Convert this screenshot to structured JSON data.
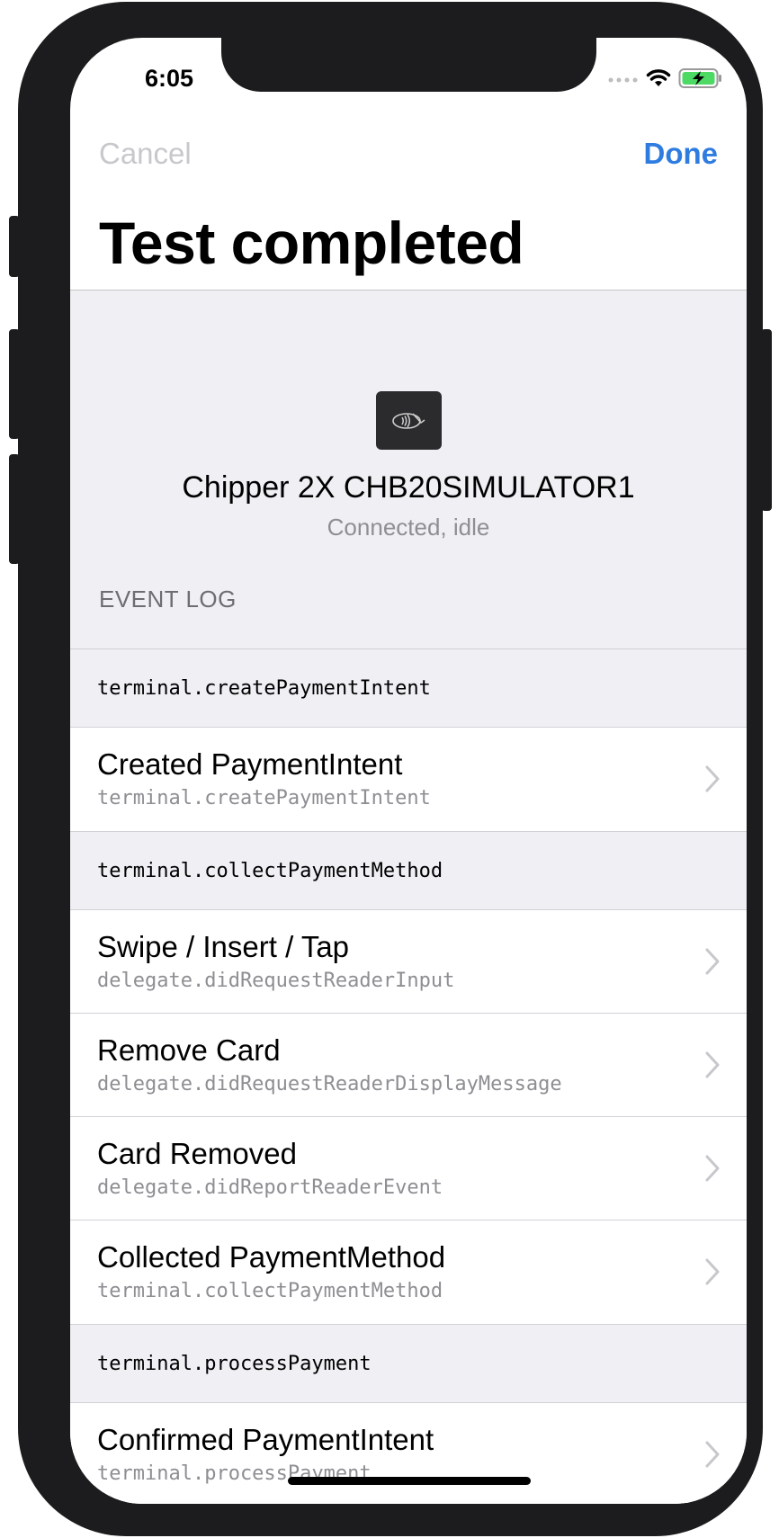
{
  "status_bar": {
    "time": "6:05",
    "icons": [
      "signal-icon",
      "wifi-icon",
      "battery-charging-icon"
    ]
  },
  "nav": {
    "cancel_label": "Cancel",
    "done_label": "Done",
    "title": "Test completed"
  },
  "reader": {
    "icon": "contactless-reader-icon",
    "name": "Chipper 2X CHB20SIMULATOR1",
    "status": "Connected, idle"
  },
  "event_log": {
    "header": "EVENT LOG",
    "groups": [
      {
        "header": "terminal.createPaymentIntent",
        "events": [
          {
            "title": "Created PaymentIntent",
            "subtitle": "terminal.createPaymentIntent"
          }
        ]
      },
      {
        "header": "terminal.collectPaymentMethod",
        "events": [
          {
            "title": "Swipe / Insert / Tap",
            "subtitle": "delegate.didRequestReaderInput"
          },
          {
            "title": "Remove Card",
            "subtitle": "delegate.didRequestReaderDisplayMessage"
          },
          {
            "title": "Card Removed",
            "subtitle": "delegate.didReportReaderEvent"
          },
          {
            "title": "Collected PaymentMethod",
            "subtitle": "terminal.collectPaymentMethod"
          }
        ]
      },
      {
        "header": "terminal.processPayment",
        "events": [
          {
            "title": "Confirmed PaymentIntent",
            "subtitle": "terminal.processPayment"
          }
        ]
      }
    ]
  },
  "colors": {
    "accent": "#2f7ce0",
    "disabled": "#c8c8cc",
    "background_grouped": "#efeff4",
    "secondary_text": "#8e8e93",
    "battery_fill": "#4cd964"
  }
}
